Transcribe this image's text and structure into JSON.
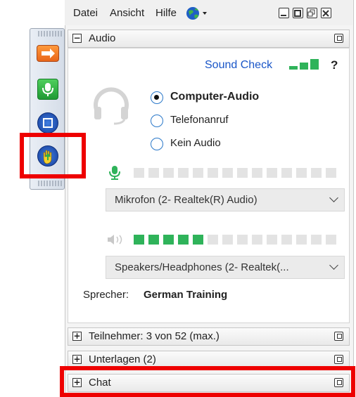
{
  "menu": {
    "file": "Datei",
    "view": "Ansicht",
    "help": "Hilfe"
  },
  "audio": {
    "title": "Audio",
    "sound_check": "Sound Check",
    "help_mark": "?",
    "options": [
      "Computer-Audio",
      "Telefonanruf",
      "Kein Audio"
    ],
    "selected_option": "Computer-Audio",
    "mic_device": "Mikrofon (2- Realtek(R) Audio)",
    "speaker_device": "Speakers/Headphones  (2- Realtek(...",
    "speaker_level_segments": 5,
    "total_segments": 14,
    "mic_level_segments": 0,
    "speaker_label": "Sprecher:",
    "speaker_name": "German Training"
  },
  "sections": {
    "participants_label": "Teilnehmer:",
    "participants_count": "3 von 52 (max.)",
    "materials": "Unterlagen (2)",
    "chat": "Chat"
  },
  "colors": {
    "accent_blue": "#1a56c8",
    "level_green": "#2fb35a",
    "highlight_red": "#ee0000"
  }
}
